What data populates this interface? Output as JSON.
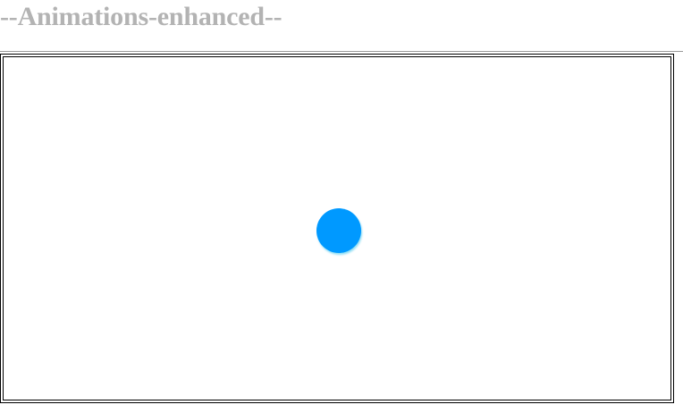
{
  "page": {
    "title": "--Animations-enhanced--"
  },
  "stage": {
    "ball_color": "#0099ff"
  }
}
